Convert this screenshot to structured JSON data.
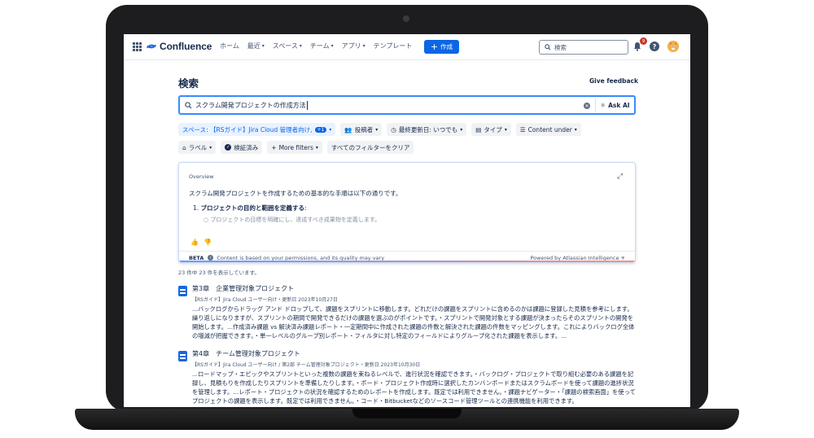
{
  "nav": {
    "app_name": "Confluence",
    "items": [
      {
        "label": "ホーム",
        "dropdown": false
      },
      {
        "label": "最近",
        "dropdown": true
      },
      {
        "label": "スペース",
        "dropdown": true
      },
      {
        "label": "チーム",
        "dropdown": true
      },
      {
        "label": "アプリ",
        "dropdown": true
      },
      {
        "label": "テンプレート",
        "dropdown": false
      }
    ],
    "create_label": "作成",
    "search_placeholder": "検索",
    "notification_count": "9"
  },
  "page": {
    "title": "検索",
    "give_feedback": "Give feedback"
  },
  "search": {
    "query": "スクラム開発プロジェクトの作成方法",
    "ask_ai": "Ask AI"
  },
  "filters": {
    "space": "スペース: 【RSガイド】Jira Cloud 管理者向け,",
    "space_count": "+1",
    "contributor": "投稿者",
    "last_updated": "最終更新日: いつでも",
    "type": "タイプ",
    "content_under": "Content under",
    "label": "ラベル",
    "verified": "検証済み",
    "more_filters": "More filters",
    "clear_all": "すべてのフィルターをクリア"
  },
  "overview": {
    "label": "Overview",
    "summary": "スクラム開発プロジェクトを作成するための基本的な手順は以下の通りです。",
    "step_number": "1.",
    "step_title": "プロジェクトの目的と範囲を定義する",
    "step_sub": "プロジェクトの目標を明確にし、達成すべき成果物を定義します。",
    "beta": "BETA",
    "disclaimer": "Content is based on your permissions, and its quality may vary",
    "powered_by": "Powered by Atlassian Intelligence"
  },
  "results": {
    "count_text": "23 件中 23 件を表示しています。",
    "items": [
      {
        "title": "第3章　企業管理対象プロジェクト",
        "meta": "【RSガイド】Jira Cloud ユーザー向け・更新日 2023年10月27日",
        "excerpt": "...バックログからドラッグ アンド ドロップして、課題をスプリントに移動します。どれだけの課題をスプリントに含めるのかは課題に登録した見積を参考にします。繰り返しになりますが、スプリントの期間で開発できるだけの課題を選ぶのがポイントです。・スプリントで開発対象とする課題が決まったらそのスプリントの開発を開始します。...作成済み課題 vs 解決済み課題レポート・一定期間中に作成された課題の件数と解決された課題の件数をマッピングします。これによりバックログ全体の増減が把握できます。・単一レベルのグループ別レポート・フィルタに対し特定のフィールドによりグループ化された課題を表示します。..."
      },
      {
        "title": "第4章　チーム管理対象プロジェクト",
        "meta": "【RSガイド】Jira Cloud ユーザー向け / 第2部 チーム管理対象プロジェクト・更新日 2023年10月30日",
        "excerpt": "...ロードマップ・エピックやスプリントといった複数の課題を束ねるレベルで、進行状況を確認できます。・バックログ・プロジェクトで取り組む必要のある課題を記録し、見積もりを作成したりスプリントを準備したりします。・ボード・プロジェクト作成時に選択したカンバンボードまたはスクラムボードを使って課題の進捗状況を管理します。...レポート・プロジェクトの状況を確認するためのレポートを作成します。既定では利用できません。・課題ナビゲーター・「課題の検索画面」を使ってプロジェクトの課題を表示します。既定では利用できません。・コード・Bitbucketなどのソースコード管理ツールとの連携機能を利用できます。"
      }
    ]
  },
  "colors": {
    "brand": "#0c66e4",
    "text": "#172b4d",
    "subtle": "#44546f"
  }
}
